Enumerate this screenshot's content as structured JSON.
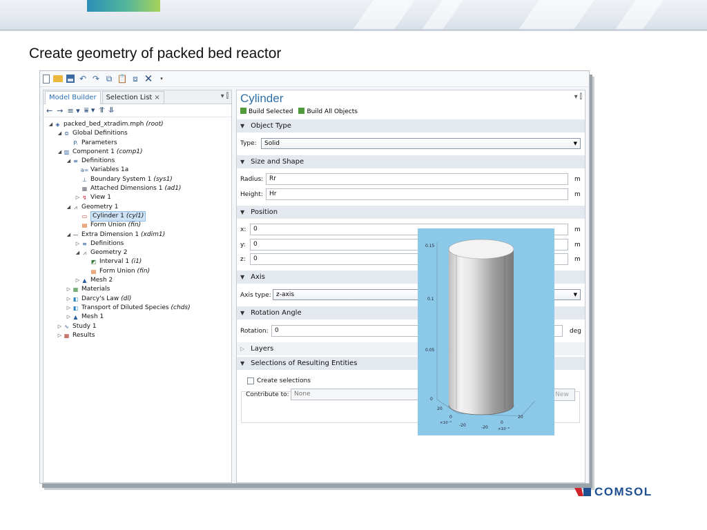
{
  "slide": {
    "title": "Create geometry of packed bed reactor",
    "brand": "COMSOL"
  },
  "colors": {
    "accent_blue": "#2f6fa8",
    "section_bg": "#e4e9ef",
    "selection": "#cfe3f7",
    "plot_bg": "#8cc9e8",
    "brand_red": "#d0242b",
    "brand_blue": "#1d4f91"
  },
  "quick_access": {
    "icons": [
      "new-file-icon",
      "open-folder-icon",
      "save-icon",
      "undo-icon",
      "redo-icon",
      "copy-icon",
      "paste-icon",
      "duplicate-icon",
      "delete-icon",
      "dropdown-icon"
    ]
  },
  "left_pane": {
    "tabs": [
      {
        "label": "Model Builder",
        "active": true
      },
      {
        "label": "Selection List",
        "active": false
      }
    ],
    "tab_close": "×",
    "pane_controls": "▾ ⫿",
    "toolbar": [
      "←",
      "→",
      "≡ ▾",
      "⩸ ▾",
      "⥣",
      "⥥"
    ],
    "tree": [
      {
        "label": "packed_bed_xtradim.mph",
        "tag": "(root)",
        "arrow": "◢",
        "icon": "mph-file-icon"
      },
      {
        "label": "Global Definitions",
        "tag": "",
        "arrow": "◢",
        "icon": "global-definitions-icon"
      },
      {
        "label": "Parameters",
        "tag": "",
        "arrow": "",
        "icon": "parameters-icon"
      },
      {
        "label": "Component 1",
        "tag": "(comp1)",
        "arrow": "◢",
        "icon": "component-icon"
      },
      {
        "label": "Definitions",
        "tag": "",
        "arrow": "◢",
        "icon": "definitions-icon"
      },
      {
        "label": "Variables 1a",
        "tag": "",
        "arrow": "",
        "icon": "variables-icon"
      },
      {
        "label": "Boundary System 1",
        "tag": "(sys1)",
        "arrow": "",
        "icon": "boundary-system-icon"
      },
      {
        "label": "Attached Dimensions 1",
        "tag": "(ad1)",
        "arrow": "",
        "icon": "attached-dimensions-icon"
      },
      {
        "label": "View 1",
        "tag": "",
        "arrow": "▷",
        "icon": "view-icon"
      },
      {
        "label": "Geometry 1",
        "tag": "",
        "arrow": "◢",
        "icon": "geometry-icon"
      },
      {
        "label": "Cylinder 1",
        "tag": "(cyl1)",
        "arrow": "",
        "icon": "cylinder-icon",
        "selected": true
      },
      {
        "label": "Form Union",
        "tag": "(fin)",
        "arrow": "",
        "icon": "form-union-icon"
      },
      {
        "label": "Extra Dimension 1",
        "tag": "(xdim1)",
        "arrow": "◢",
        "icon": "extra-dimension-icon"
      },
      {
        "label": "Definitions",
        "tag": "",
        "arrow": "▷",
        "icon": "definitions-icon"
      },
      {
        "label": "Geometry 2",
        "tag": "",
        "arrow": "◢",
        "icon": "geometry-icon"
      },
      {
        "label": "Interval 1",
        "tag": "(i1)",
        "arrow": "",
        "icon": "interval-icon"
      },
      {
        "label": "Form Union",
        "tag": "(fin)",
        "arrow": "",
        "icon": "form-union-icon"
      },
      {
        "label": "Mesh 2",
        "tag": "",
        "arrow": "▷",
        "icon": "mesh-icon"
      },
      {
        "label": "Materials",
        "tag": "",
        "arrow": "▷",
        "icon": "materials-icon"
      },
      {
        "label": "Darcy's Law",
        "tag": "(dl)",
        "arrow": "▷",
        "icon": "physics-icon"
      },
      {
        "label": "Transport of Diluted Species",
        "tag": "(chds)",
        "arrow": "▷",
        "icon": "physics-icon"
      },
      {
        "label": "Mesh 1",
        "tag": "",
        "arrow": "▷",
        "icon": "mesh-icon"
      },
      {
        "label": "Study 1",
        "tag": "",
        "arrow": "▷",
        "icon": "study-icon"
      },
      {
        "label": "Results",
        "tag": "",
        "arrow": "▷",
        "icon": "results-icon"
      }
    ]
  },
  "right_pane": {
    "title": "Cylinder",
    "controls": "▾ ⫿",
    "build_selected": "Build Selected",
    "build_all": "Build All Objects",
    "sections": {
      "object_type": "Object Type",
      "size_shape": "Size and Shape",
      "position": "Position",
      "axis": "Axis",
      "rotation": "Rotation Angle",
      "layers": "Layers",
      "resulting": "Selections of Resulting Entities"
    },
    "type_label": "Type:",
    "type_value": "Solid",
    "radius_label": "Radius:",
    "radius_value": "Rr",
    "height_label": "Height:",
    "height_value": "Hr",
    "unit_m": "m",
    "x_label": "x:",
    "y_label": "y:",
    "z_label": "z:",
    "x_value": "0",
    "y_value": "0",
    "z_value": "0",
    "axis_type_label": "Axis type:",
    "axis_type_value": "z-axis",
    "rotation_label": "Rotation:",
    "rotation_value": "0",
    "unit_deg": "deg",
    "create_selections": "Create selections",
    "contribute_to_label": "Contribute to:",
    "contribute_to_value": "None",
    "new_button": "New"
  },
  "plot3d": {
    "z_ticks": [
      "0.15",
      "0.1",
      "0.05",
      "0"
    ],
    "x_ticks": [
      "20",
      "0",
      "-20"
    ],
    "y_ticks": [
      "-20",
      "0",
      "20"
    ],
    "x_multiplier": "×10⁻³",
    "y_multiplier": "×10⁻³"
  }
}
